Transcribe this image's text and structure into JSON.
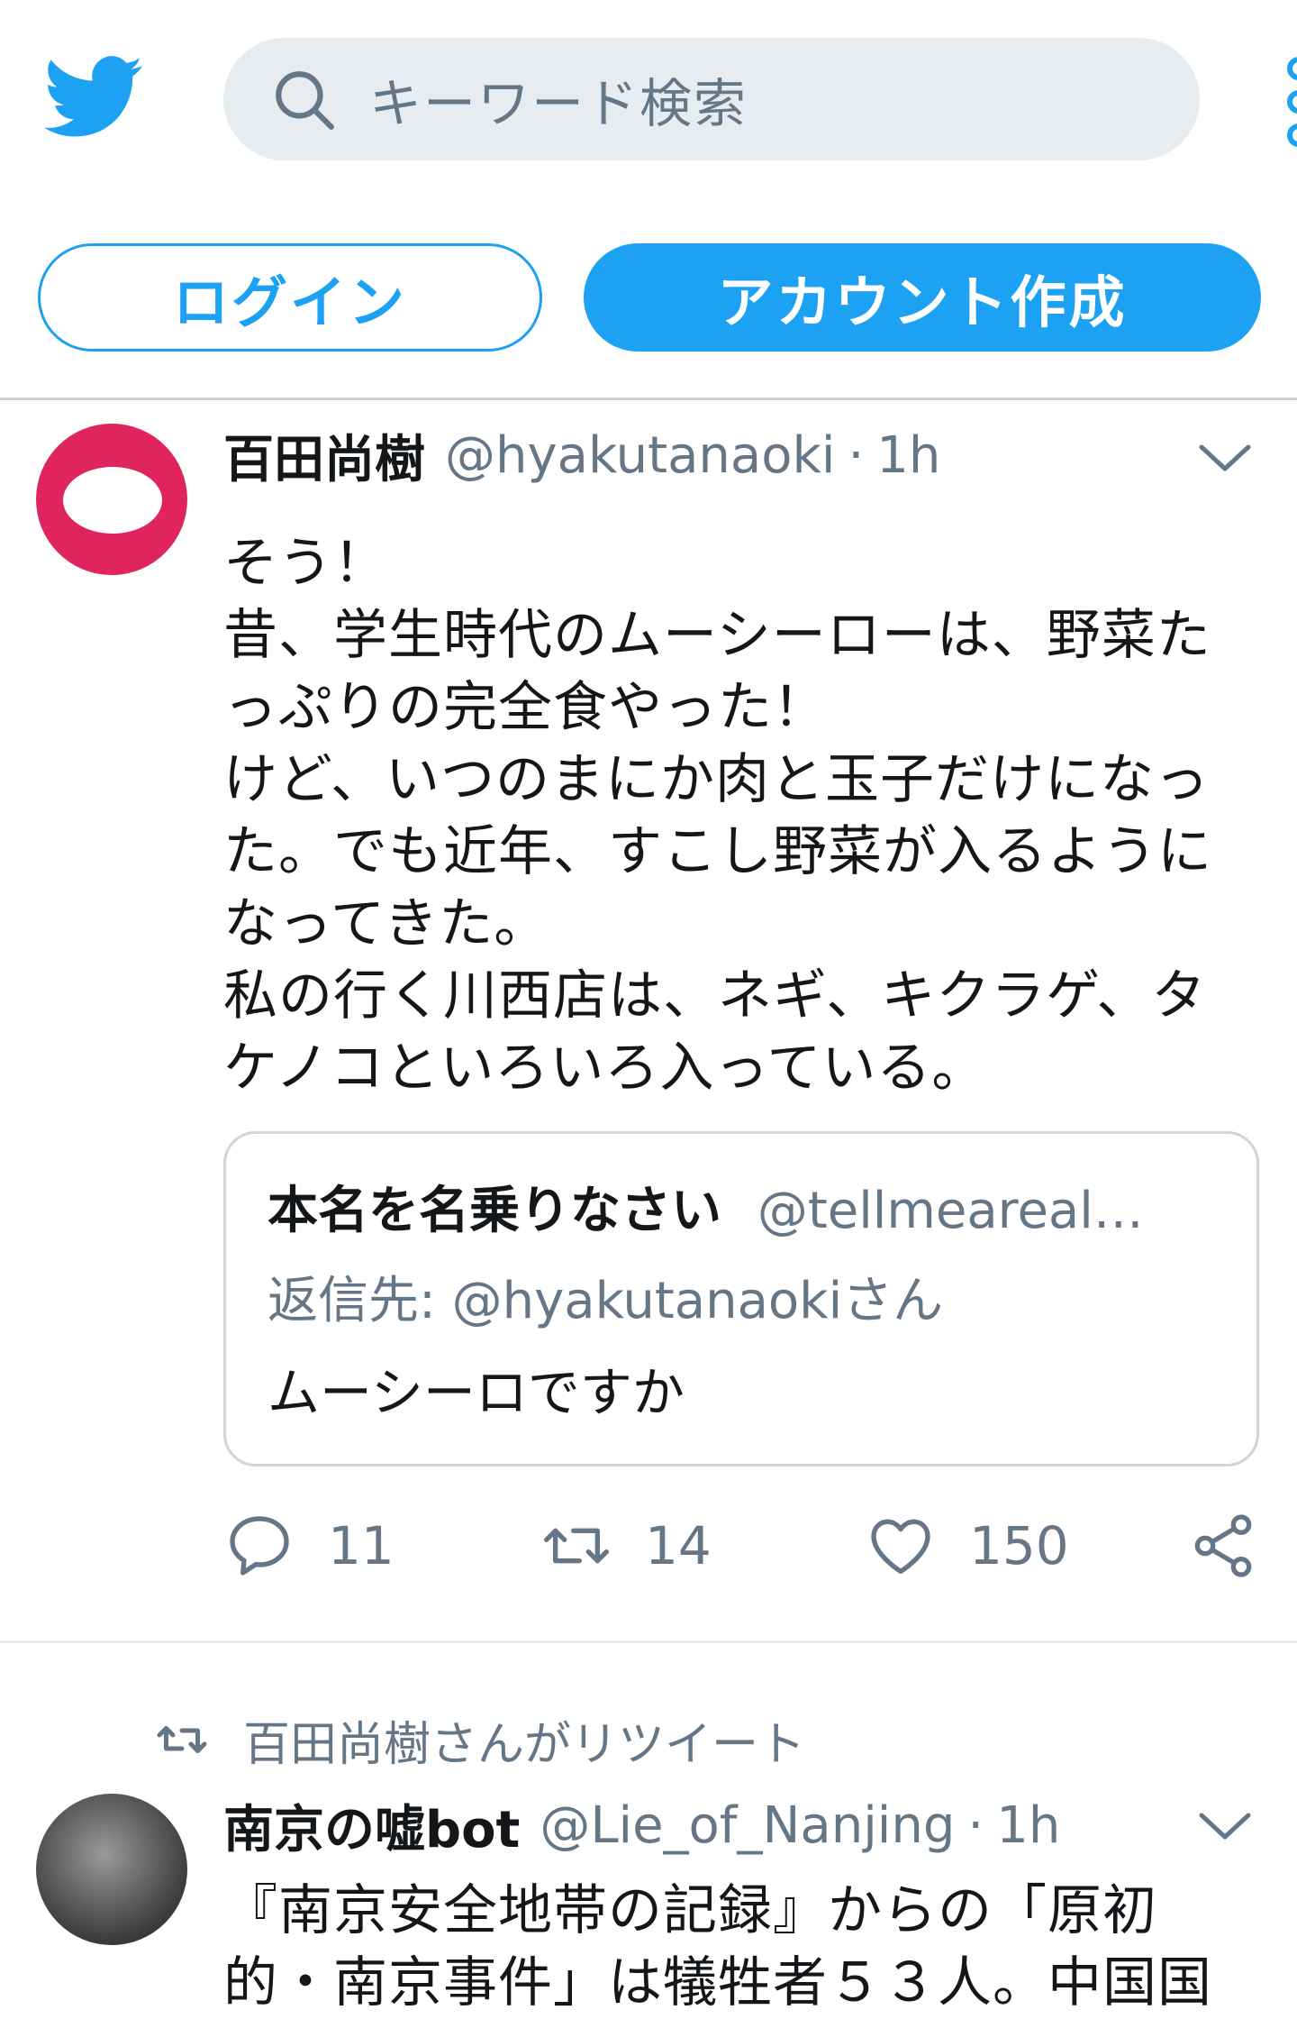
{
  "header": {
    "logo_icon": "twitter-bird-icon",
    "search_placeholder": "キーワード検索",
    "menu_icon": "more-icon"
  },
  "auth": {
    "login_label": "ログイン",
    "signup_label": "アカウント作成"
  },
  "colors": {
    "accent": "#1da1f2",
    "muted": "#657786",
    "avatar1": "#e0245e"
  },
  "tweet1": {
    "name": "百田尚樹",
    "handle": "@hyakutanaoki",
    "separator": "·",
    "time": "1h",
    "lines": [
      "そう！",
      "昔、学生時代のムーシーローは、野菜た",
      "っぷりの完全食やった！",
      "けど、いつのまにか肉と玉子だけになっ",
      "た。でも近年、すこし野菜が入るように",
      "なってきた。",
      "私の行く川西店は、ネギ、キクラゲ、タ",
      "ケノコといろいろ入っている。"
    ],
    "quote": {
      "name": "本名を名乗りなさい",
      "handle": "@tellmeareal…",
      "reply_prefix": "返信先: ",
      "reply_to": "@hyakutanaokiさん",
      "text": "ムーシーロですか"
    },
    "actions": {
      "reply_count": "11",
      "retweet_count": "14",
      "like_count": "150"
    }
  },
  "retweet_notice": "百田尚樹さんがリツイート",
  "tweet2": {
    "name": "南京の嘘bot",
    "handle": "@Lie_of_Nanjing",
    "separator": "·",
    "time": "1h",
    "lines": [
      "『南京安全地帯の記録』からの「原初",
      "的・南京事件」は犠牲者５３人。中国国"
    ]
  }
}
